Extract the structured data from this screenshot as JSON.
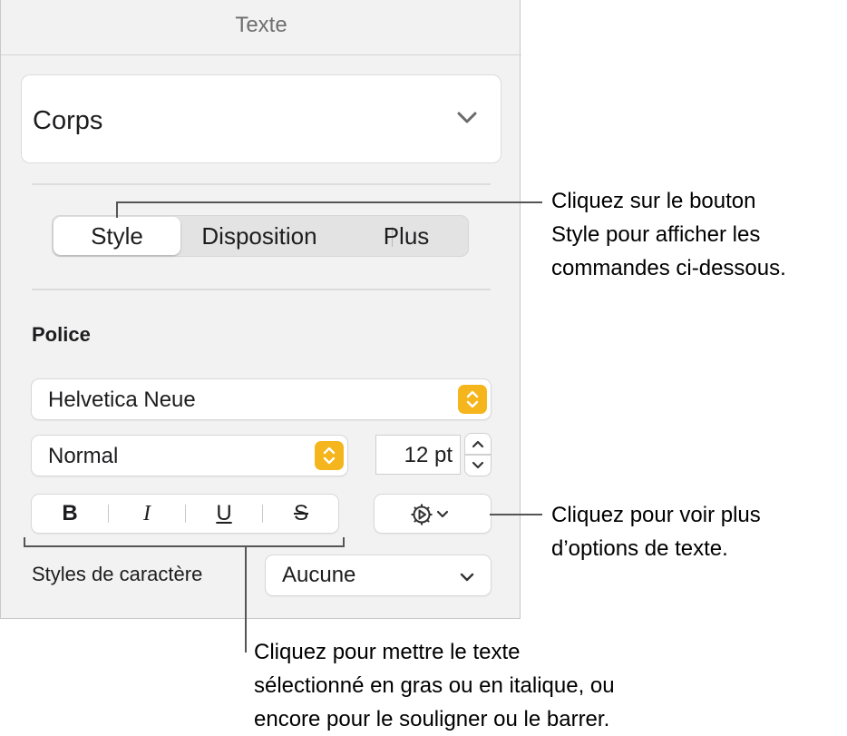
{
  "panel": {
    "title": "Texte",
    "paragraph_style": "Corps",
    "tabs": [
      {
        "label": "Style",
        "active": true
      },
      {
        "label": "Disposition",
        "active": false
      },
      {
        "label": "Plus",
        "active": false
      }
    ],
    "font_section_label": "Police",
    "font_family": "Helvetica Neue",
    "font_typeface": "Normal",
    "font_size": "12 pt",
    "format_buttons": [
      {
        "label": "B",
        "name": "bold"
      },
      {
        "label": "I",
        "name": "italic"
      },
      {
        "label": "U",
        "name": "underline"
      },
      {
        "label": "S",
        "name": "strikethrough"
      }
    ],
    "character_styles_label": "Styles de caractère",
    "character_style_value": "Aucune",
    "accent_color": "#f5b51c"
  },
  "callouts": {
    "style_button": [
      "Cliquez sur le bouton",
      "Style pour afficher les",
      "commandes ci-dessous."
    ],
    "more_options": [
      "Cliquez pour voir plus",
      "d’options de texte."
    ],
    "format_buttons": [
      "Cliquez pour mettre le texte",
      "sélectionné en gras ou en italique, ou",
      "encore pour le souligner ou le barrer."
    ]
  }
}
